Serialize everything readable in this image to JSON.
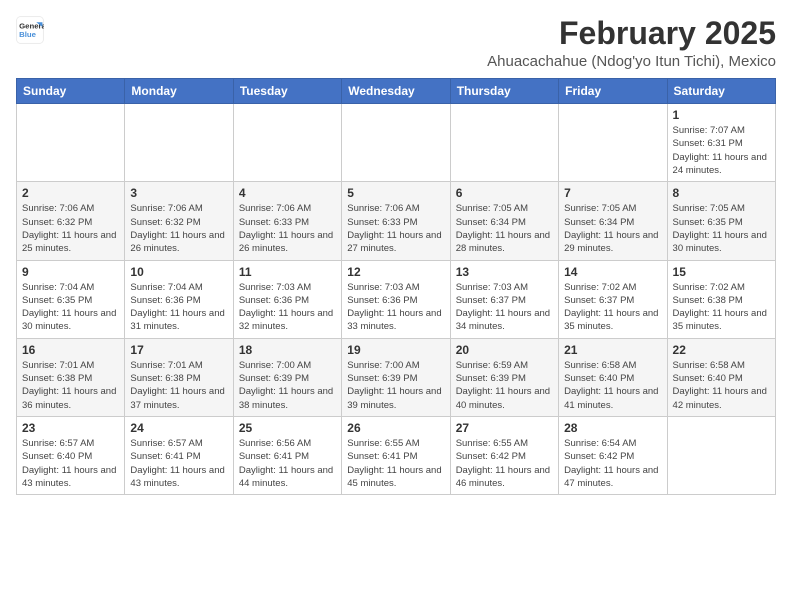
{
  "logo": {
    "line1": "General",
    "line2": "Blue"
  },
  "title": "February 2025",
  "location": "Ahuacachahue (Ndog'yo Itun Tichi), Mexico",
  "days_of_week": [
    "Sunday",
    "Monday",
    "Tuesday",
    "Wednesday",
    "Thursday",
    "Friday",
    "Saturday"
  ],
  "weeks": [
    [
      {
        "day": "",
        "info": ""
      },
      {
        "day": "",
        "info": ""
      },
      {
        "day": "",
        "info": ""
      },
      {
        "day": "",
        "info": ""
      },
      {
        "day": "",
        "info": ""
      },
      {
        "day": "",
        "info": ""
      },
      {
        "day": "1",
        "info": "Sunrise: 7:07 AM\nSunset: 6:31 PM\nDaylight: 11 hours and 24 minutes."
      }
    ],
    [
      {
        "day": "2",
        "info": "Sunrise: 7:06 AM\nSunset: 6:32 PM\nDaylight: 11 hours and 25 minutes."
      },
      {
        "day": "3",
        "info": "Sunrise: 7:06 AM\nSunset: 6:32 PM\nDaylight: 11 hours and 26 minutes."
      },
      {
        "day": "4",
        "info": "Sunrise: 7:06 AM\nSunset: 6:33 PM\nDaylight: 11 hours and 26 minutes."
      },
      {
        "day": "5",
        "info": "Sunrise: 7:06 AM\nSunset: 6:33 PM\nDaylight: 11 hours and 27 minutes."
      },
      {
        "day": "6",
        "info": "Sunrise: 7:05 AM\nSunset: 6:34 PM\nDaylight: 11 hours and 28 minutes."
      },
      {
        "day": "7",
        "info": "Sunrise: 7:05 AM\nSunset: 6:34 PM\nDaylight: 11 hours and 29 minutes."
      },
      {
        "day": "8",
        "info": "Sunrise: 7:05 AM\nSunset: 6:35 PM\nDaylight: 11 hours and 30 minutes."
      }
    ],
    [
      {
        "day": "9",
        "info": "Sunrise: 7:04 AM\nSunset: 6:35 PM\nDaylight: 11 hours and 30 minutes."
      },
      {
        "day": "10",
        "info": "Sunrise: 7:04 AM\nSunset: 6:36 PM\nDaylight: 11 hours and 31 minutes."
      },
      {
        "day": "11",
        "info": "Sunrise: 7:03 AM\nSunset: 6:36 PM\nDaylight: 11 hours and 32 minutes."
      },
      {
        "day": "12",
        "info": "Sunrise: 7:03 AM\nSunset: 6:36 PM\nDaylight: 11 hours and 33 minutes."
      },
      {
        "day": "13",
        "info": "Sunrise: 7:03 AM\nSunset: 6:37 PM\nDaylight: 11 hours and 34 minutes."
      },
      {
        "day": "14",
        "info": "Sunrise: 7:02 AM\nSunset: 6:37 PM\nDaylight: 11 hours and 35 minutes."
      },
      {
        "day": "15",
        "info": "Sunrise: 7:02 AM\nSunset: 6:38 PM\nDaylight: 11 hours and 35 minutes."
      }
    ],
    [
      {
        "day": "16",
        "info": "Sunrise: 7:01 AM\nSunset: 6:38 PM\nDaylight: 11 hours and 36 minutes."
      },
      {
        "day": "17",
        "info": "Sunrise: 7:01 AM\nSunset: 6:38 PM\nDaylight: 11 hours and 37 minutes."
      },
      {
        "day": "18",
        "info": "Sunrise: 7:00 AM\nSunset: 6:39 PM\nDaylight: 11 hours and 38 minutes."
      },
      {
        "day": "19",
        "info": "Sunrise: 7:00 AM\nSunset: 6:39 PM\nDaylight: 11 hours and 39 minutes."
      },
      {
        "day": "20",
        "info": "Sunrise: 6:59 AM\nSunset: 6:39 PM\nDaylight: 11 hours and 40 minutes."
      },
      {
        "day": "21",
        "info": "Sunrise: 6:58 AM\nSunset: 6:40 PM\nDaylight: 11 hours and 41 minutes."
      },
      {
        "day": "22",
        "info": "Sunrise: 6:58 AM\nSunset: 6:40 PM\nDaylight: 11 hours and 42 minutes."
      }
    ],
    [
      {
        "day": "23",
        "info": "Sunrise: 6:57 AM\nSunset: 6:40 PM\nDaylight: 11 hours and 43 minutes."
      },
      {
        "day": "24",
        "info": "Sunrise: 6:57 AM\nSunset: 6:41 PM\nDaylight: 11 hours and 43 minutes."
      },
      {
        "day": "25",
        "info": "Sunrise: 6:56 AM\nSunset: 6:41 PM\nDaylight: 11 hours and 44 minutes."
      },
      {
        "day": "26",
        "info": "Sunrise: 6:55 AM\nSunset: 6:41 PM\nDaylight: 11 hours and 45 minutes."
      },
      {
        "day": "27",
        "info": "Sunrise: 6:55 AM\nSunset: 6:42 PM\nDaylight: 11 hours and 46 minutes."
      },
      {
        "day": "28",
        "info": "Sunrise: 6:54 AM\nSunset: 6:42 PM\nDaylight: 11 hours and 47 minutes."
      },
      {
        "day": "",
        "info": ""
      }
    ]
  ]
}
